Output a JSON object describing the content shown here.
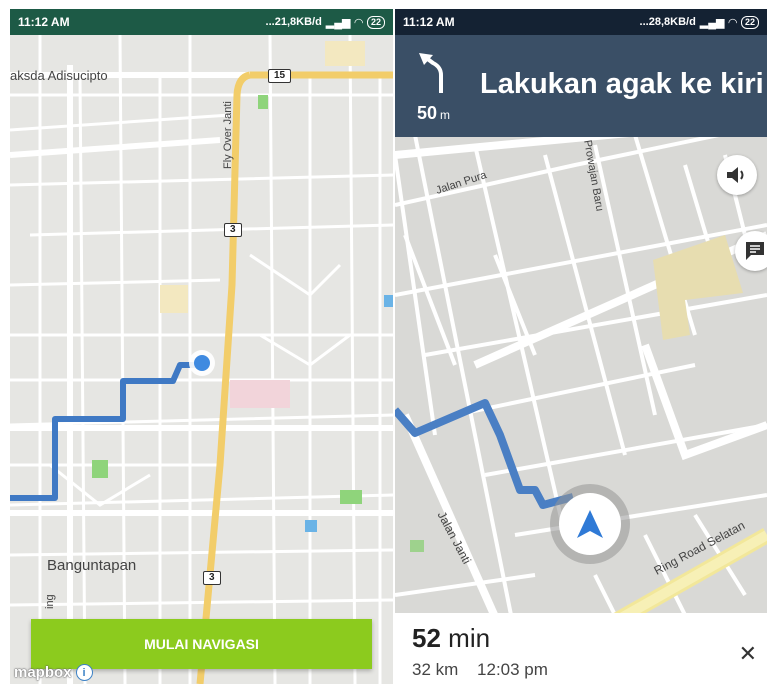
{
  "left": {
    "status": {
      "time": "11:12 AM",
      "network": "...21,8KB/d",
      "battery": "22"
    },
    "map_labels": {
      "street_adisucipto": "aksda Adisucipto",
      "road_15": "15",
      "fly_over": "Fly Over Janti",
      "road_3_top": "3",
      "road_3_bottom": "3",
      "district": "Banguntapan",
      "vertical_street": "ing"
    },
    "start_button": "MULAI NAVIGASI",
    "attribution": "mapbox"
  },
  "right": {
    "status": {
      "time": "11:12 AM",
      "network": "...28,8KB/d",
      "battery": "22"
    },
    "banner": {
      "distance": "50",
      "distance_unit": "m",
      "instruction": "Lakukan agak ke kiri"
    },
    "map_labels": {
      "jalan_pura": "Jalan Pura",
      "prowajan": "Prowajan Baru",
      "jalan_janti": "Jalan Janti",
      "ring_road": "Ring Road Selatan"
    },
    "trip": {
      "duration_value": "52",
      "duration_unit": "min",
      "distance": "32 km",
      "arrival": "12:03 pm"
    }
  },
  "colors": {
    "route": "#3f79c4",
    "major_road": "#f2cd6a",
    "left_status": "#1d5a46",
    "banner": "#3a4f66",
    "start_button": "#8ccb1e"
  },
  "icons": [
    "wifi-icon",
    "signal-icon",
    "turn-slight-left-icon",
    "volume-icon",
    "feedback-icon",
    "navigation-arrow-icon",
    "close-icon",
    "info-icon",
    "user-location-dot"
  ]
}
